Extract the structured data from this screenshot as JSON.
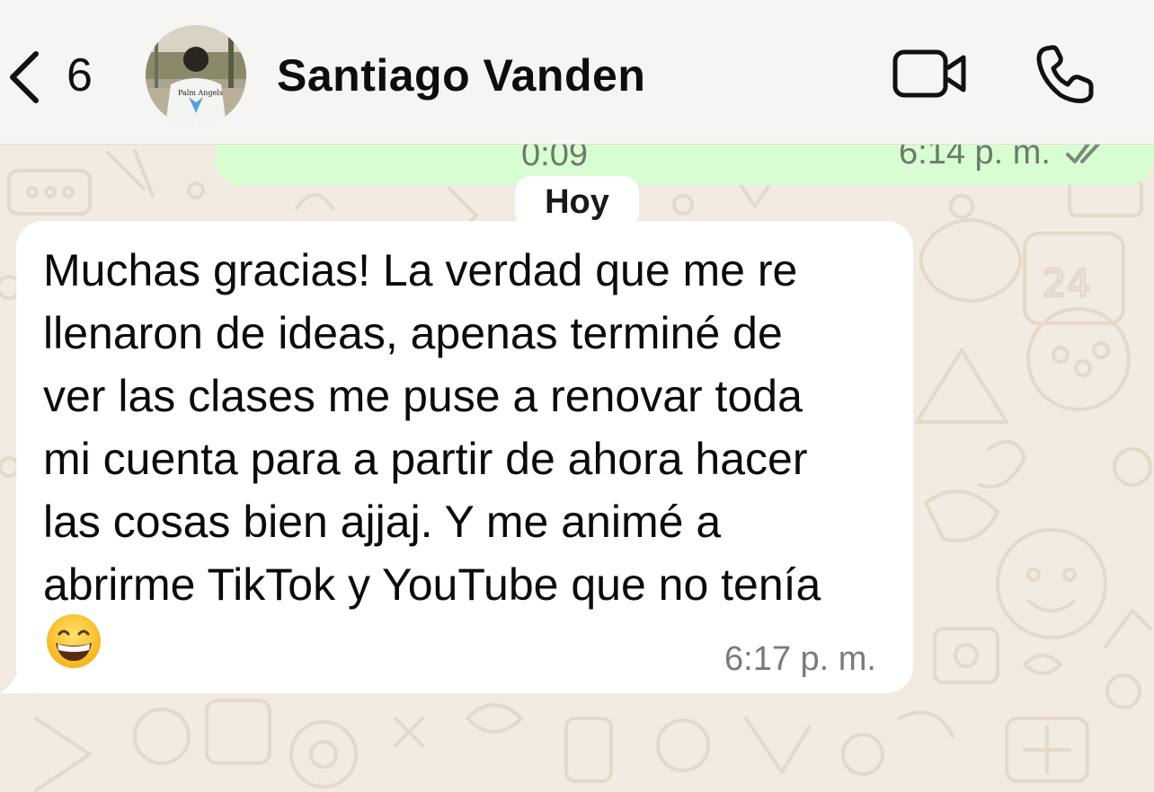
{
  "header": {
    "back_count": "6",
    "contact_name": "Santiago Vanden",
    "avatar_icon": "contact-avatar-photo",
    "video_icon": "video-camera-icon",
    "call_icon": "phone-icon"
  },
  "messages": {
    "outgoing": {
      "duration": "0:09",
      "time": "6:14 p. m.",
      "status_icon": "double-check-icon"
    },
    "date_separator": "Hoy",
    "incoming": {
      "lines": [
        "Muchas gracias! La verdad que me re",
        "llenaron de ideas, apenas terminé de",
        "ver las clases me puse a renovar toda",
        "mi cuenta para a partir de ahora hacer",
        "las cosas bien ajjaj. Y me animé a",
        "abrirme TikTok y YouTube que no tenía"
      ],
      "emoji": "😁",
      "time": "6:17 p. m."
    }
  },
  "colors": {
    "header_bg": "#f6f5f3",
    "chat_bg": "#f1ebe2",
    "outgoing_bubble": "#d9fdd3",
    "incoming_bubble": "#ffffff",
    "read_tick": "#7a8a78"
  }
}
